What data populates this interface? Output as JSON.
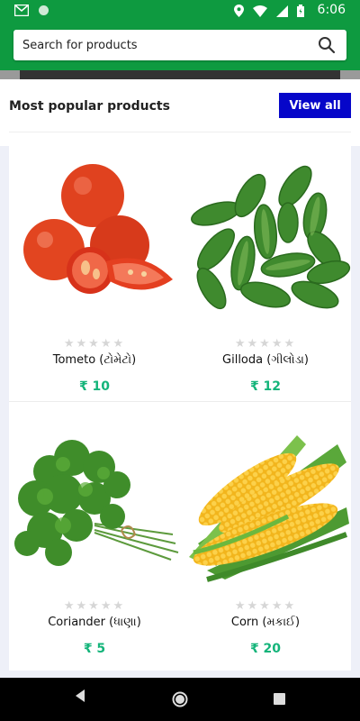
{
  "status_bar": {
    "time": "6:06",
    "icons": [
      "gmail-icon",
      "circle-icon",
      "location-icon",
      "wifi-icon",
      "signal-icon",
      "battery-icon"
    ]
  },
  "search": {
    "placeholder": "Search for products"
  },
  "section": {
    "title": "Most popular products",
    "view_all": "View all"
  },
  "products": [
    {
      "name": "Tometo (ટોમેટો)",
      "price": "₹ 10",
      "rating": 0,
      "image": "tomato"
    },
    {
      "name": "Gilloda (ગીલોડા)",
      "price": "₹ 12",
      "rating": 0,
      "image": "gilloda"
    },
    {
      "name": "Coriander (ધાણા)",
      "price": "₹ 5",
      "rating": 0,
      "image": "coriander"
    },
    {
      "name": "Corn (મકાઈ)",
      "price": "₹ 20",
      "rating": 0,
      "image": "corn"
    }
  ],
  "colors": {
    "primary": "#0e9a40",
    "button": "#0606c9",
    "price": "#14b47a"
  }
}
